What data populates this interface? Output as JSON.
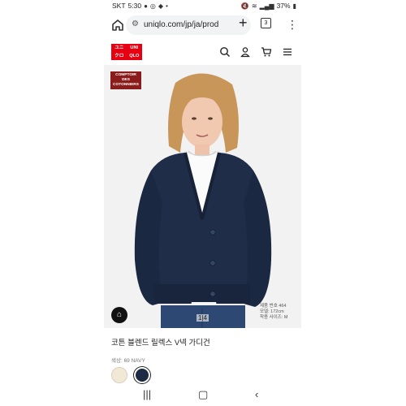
{
  "status_bar": {
    "carrier": "SKT",
    "time": "5:30",
    "dot": "•",
    "battery": "37%"
  },
  "browser": {
    "url": "uniqlo.com/jp/ja/prod",
    "tab_count": "3"
  },
  "site": {
    "logo_top_left": "UNI",
    "logo_top_right": "UNI",
    "logo_bottom_left": "QLO",
    "logo_bottom_right": "QLO",
    "logo_top_left_kana": "ユニ",
    "logo_bottom_left_kana": "クロ"
  },
  "product": {
    "badge_line1": "COMPTOIR DES",
    "badge_line2": "COTONNIERS",
    "pager": "1|4",
    "tag_line1": "제품 번호 464",
    "tag_line2": "모델: 172cm",
    "tag_line3": "착용 사이즈: M",
    "title": "코튼 블렌드 릴렉스 V넥 가디건",
    "color_label": "색상: 69 NAVY"
  },
  "colors": {
    "logo_red": "#e60012",
    "cardigan_navy": "#1c2a44",
    "swatch_cream": "#f1e8d6"
  }
}
